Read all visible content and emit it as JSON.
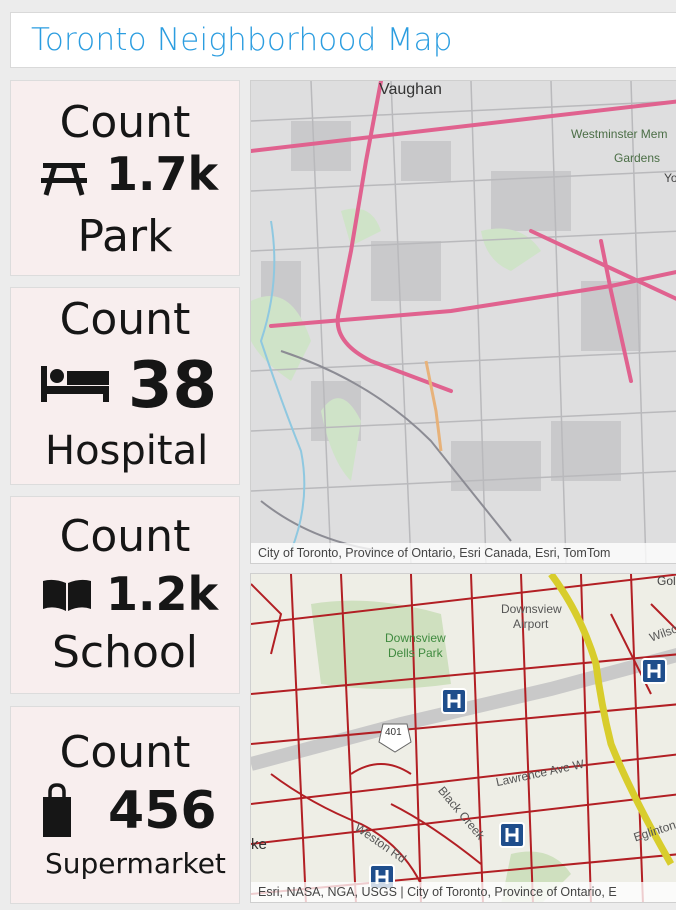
{
  "header": {
    "title": "Toronto Neighborhood Map"
  },
  "cards": [
    {
      "label": "Count",
      "value": "1.7k",
      "category": "Park",
      "icon": "picnic-table-icon"
    },
    {
      "label": "Count",
      "value": "38",
      "category": "Hospital",
      "icon": "bed-icon"
    },
    {
      "label": "Count",
      "value": "1.2k",
      "category": "School",
      "icon": "open-book-icon"
    },
    {
      "label": "Count",
      "value": "456",
      "category": "Supermarket",
      "icon": "shopping-bag-icon"
    }
  ],
  "map_top": {
    "labels": {
      "vaughan": "Vaughan",
      "westminster": "Westminster Mem",
      "gardens": "Gardens",
      "yo": "Yo"
    },
    "attribution": "City of Toronto, Province of Ontario, Esri Canada, Esri, TomTom"
  },
  "map_bottom": {
    "labels": {
      "downsview_airport_1": "Downsview",
      "downsview_airport_2": "Airport",
      "dells_1": "Downsview",
      "dells_2": "Dells Park",
      "highway": "401",
      "gol": "Gol",
      "wilson": "Wilso",
      "lawrence": "Lawrence Ave W",
      "black_creek": "Black Creek",
      "weston": "Weston Rd",
      "eglinton": "Eglinton",
      "ke": "ke"
    },
    "attribution": "Esri, NASA, NGA, USGS | City of Toronto, Province of Ontario, E"
  },
  "colors": {
    "title": "#2b9de0",
    "card_bg": "#f8eeee",
    "road_red": "#b21f24",
    "transit_yellow": "#d8cd2c",
    "hospital_blue": "#1f4e8c",
    "highway_pink": "#e0628f"
  }
}
